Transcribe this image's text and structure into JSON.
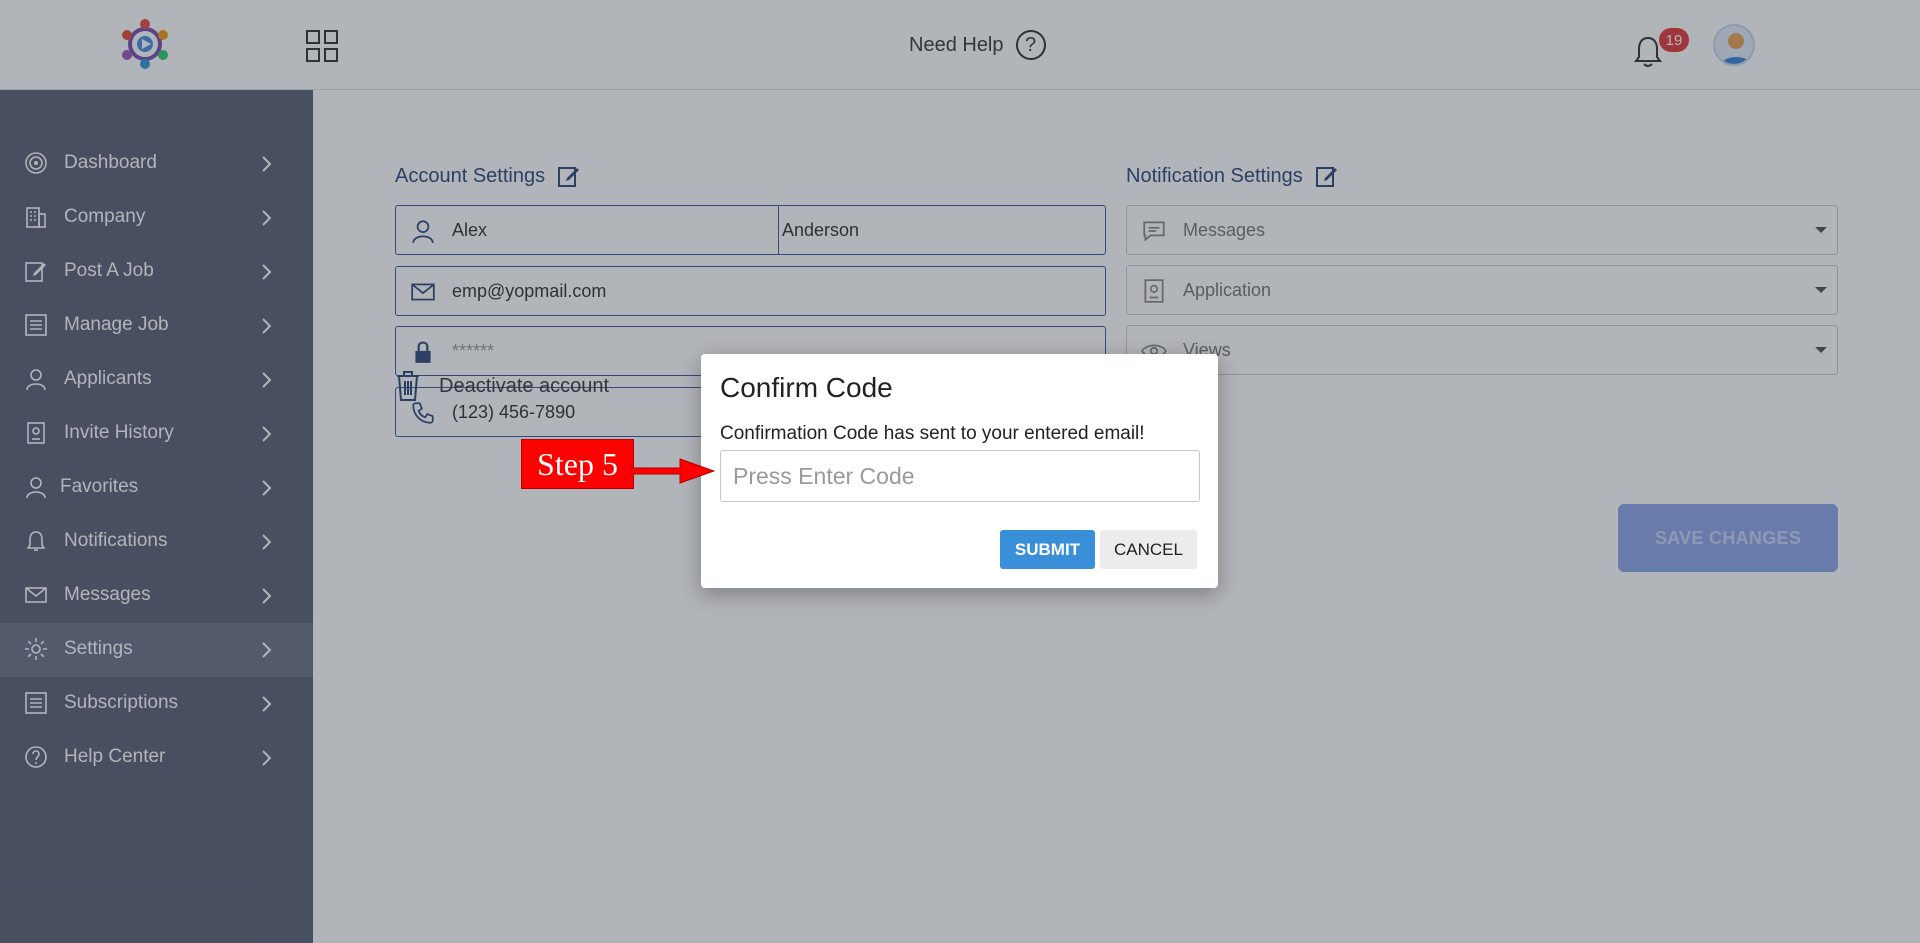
{
  "header": {
    "help_label": "Need Help",
    "help_icon": "?",
    "notification_count": "19"
  },
  "sidebar": {
    "items": [
      {
        "label": "Dashboard",
        "icon": "dashboard-icon"
      },
      {
        "label": "Company",
        "icon": "building-icon"
      },
      {
        "label": "Post A Job",
        "icon": "edit-icon"
      },
      {
        "label": "Manage Job",
        "icon": "list-icon"
      },
      {
        "label": "Applicants",
        "icon": "user-icon"
      },
      {
        "label": "Invite History",
        "icon": "document-icon"
      },
      {
        "label": "Favorites",
        "icon": "user-icon"
      },
      {
        "label": "Notifications",
        "icon": "bell-icon"
      },
      {
        "label": "Messages",
        "icon": "envelope-icon"
      },
      {
        "label": "Settings",
        "icon": "gear-icon"
      },
      {
        "label": "Subscriptions",
        "icon": "list-icon"
      },
      {
        "label": "Help Center",
        "icon": "help-icon"
      }
    ],
    "active": "Settings"
  },
  "account": {
    "title": "Account Settings",
    "first_name": "Alex",
    "last_name": "Anderson",
    "email": "emp@yopmail.com",
    "password": "******",
    "phone": "(123) 456-7890",
    "deactivate_label": "Deactivate account"
  },
  "notifications": {
    "title": "Notification Settings",
    "messages": "Messages",
    "application": "Application",
    "views": "Views"
  },
  "save_label": "SAVE CHANGES",
  "modal": {
    "title": "Confirm Code",
    "message": "Confirmation Code has sent to your entered email!",
    "placeholder": "Press Enter Code",
    "submit_label": "SUBMIT",
    "cancel_label": "CANCEL"
  },
  "annotation": {
    "step_label": "Step 5",
    "color": "#ff0000"
  }
}
